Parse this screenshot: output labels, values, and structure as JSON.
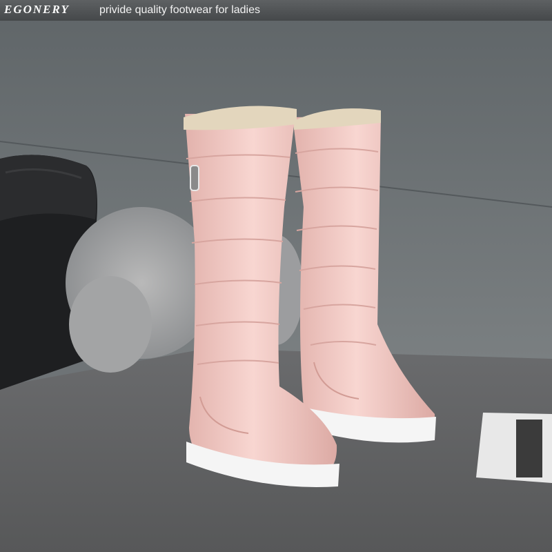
{
  "banner": {
    "brand": "EGONERY",
    "tagline": "privide quality footwear for ladies"
  },
  "photo": {
    "colors": {
      "wall": "#6b7174",
      "floor": "#626365",
      "boot": "#f1c9c4",
      "sole": "#f4f4f4",
      "fur": "#e3d6bd"
    }
  }
}
